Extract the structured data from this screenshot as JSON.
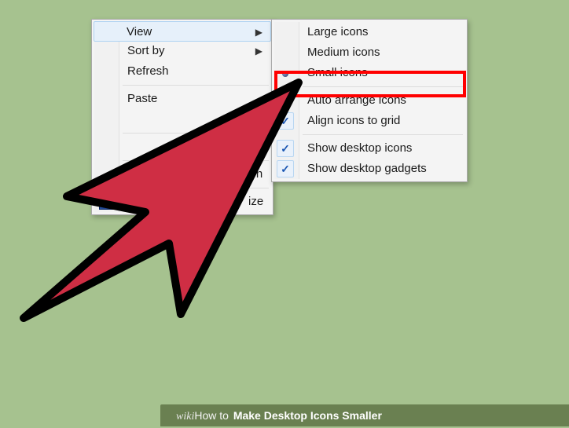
{
  "context_menu": {
    "items": [
      {
        "label": "View",
        "has_submenu": true,
        "hover": true
      },
      {
        "label": "Sort by",
        "has_submenu": true,
        "hover": false
      },
      {
        "label": "Refresh",
        "has_submenu": false,
        "hover": false
      }
    ],
    "group2": [
      {
        "label": "Paste",
        "partial": true
      }
    ],
    "new_row": {
      "has_submenu": true
    },
    "bottom_group": [
      {
        "label": "tion",
        "partial": true
      },
      {
        "label": "ize",
        "partial": true,
        "has_icon": true
      }
    ]
  },
  "submenu": {
    "size_group": [
      {
        "label": "Large icons",
        "selected": false
      },
      {
        "label": "Medium icons",
        "selected": false
      },
      {
        "label": "Small icons",
        "selected": true,
        "highlighted": true
      }
    ],
    "arrange_group": [
      {
        "label": "Auto arrange icons",
        "checked": false
      },
      {
        "label": "Align icons to grid",
        "checked": true
      }
    ],
    "show_group": [
      {
        "label": "Show desktop icons",
        "checked": true
      },
      {
        "label": "Show desktop gadgets",
        "checked": true
      }
    ]
  },
  "banner": {
    "brand_prefix": "wiki",
    "brand_suffix": "How to",
    "title": "Make Desktop Icons Smaller"
  },
  "colors": {
    "desktop_bg": "#a6c28f",
    "highlight_border": "#ff0000",
    "arrow_fill": "#cf2e44",
    "arrow_stroke": "#000000"
  }
}
